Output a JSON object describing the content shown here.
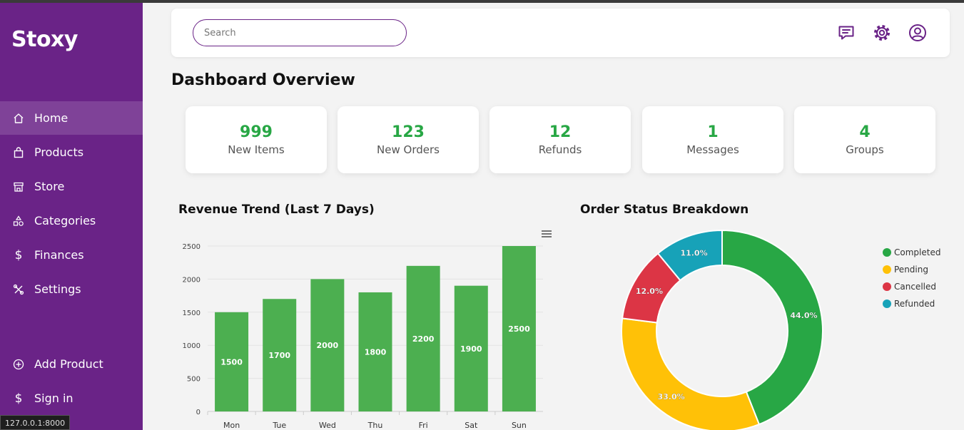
{
  "sidebar": {
    "brand": "Stoxy",
    "items": [
      {
        "label": "Home",
        "icon": "home-icon"
      },
      {
        "label": "Products",
        "icon": "bag-icon"
      },
      {
        "label": "Store",
        "icon": "store-icon"
      },
      {
        "label": "Categories",
        "icon": "shapes-icon"
      },
      {
        "label": "Finances",
        "icon": "dollar-icon"
      },
      {
        "label": "Settings",
        "icon": "tools-icon"
      }
    ],
    "bottom_items": [
      {
        "label": "Add Product",
        "icon": "plus-circle-icon"
      },
      {
        "label": "Sign in",
        "icon": "dollar-icon"
      }
    ],
    "active": "Home"
  },
  "status_url": "127.0.0.1:8000",
  "header": {
    "search_placeholder": "Search",
    "icons": [
      "message-icon",
      "gear-icon",
      "user-circle-icon"
    ]
  },
  "page_title": "Dashboard Overview",
  "stats": [
    {
      "value": "999",
      "label": "New Items"
    },
    {
      "value": "123",
      "label": "New Orders"
    },
    {
      "value": "12",
      "label": "Refunds"
    },
    {
      "value": "1",
      "label": "Messages"
    },
    {
      "value": "4",
      "label": "Groups"
    }
  ],
  "revenue_title": "Revenue Trend (Last 7 Days)",
  "order_title": "Order Status Breakdown",
  "colors": {
    "accent": "#6a2387",
    "bar": "#4caf50",
    "completed": "#28a745",
    "pending": "#ffc107",
    "cancelled": "#dc3545",
    "refunded": "#17a2b8"
  },
  "chart_data": [
    {
      "type": "bar",
      "title": "Revenue Trend (Last 7 Days)",
      "categories": [
        "Mon",
        "Tue",
        "Wed",
        "Thu",
        "Fri",
        "Sat",
        "Sun"
      ],
      "values": [
        1500,
        1700,
        2000,
        1800,
        2200,
        1900,
        2500
      ],
      "ylim": [
        0,
        2500
      ],
      "yticks": [
        0,
        500,
        1000,
        1500,
        2000,
        2500
      ],
      "grid": true
    },
    {
      "type": "pie",
      "title": "Order Status Breakdown",
      "labels": [
        "Completed",
        "Pending",
        "Cancelled",
        "Refunded"
      ],
      "values": [
        44.0,
        33.0,
        12.0,
        11.0
      ],
      "value_labels": [
        "44.0%",
        "33.0%",
        "12.0%",
        "11.0%"
      ],
      "legend": "right"
    }
  ]
}
